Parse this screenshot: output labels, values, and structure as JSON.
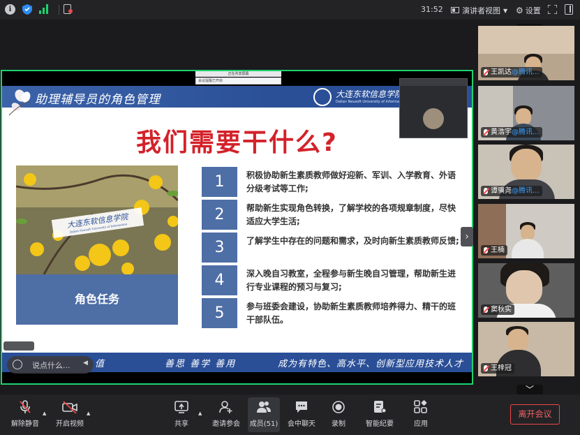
{
  "topbar": {
    "timer": "31:52",
    "presenter_view": "演讲者视图",
    "settings": "设置"
  },
  "share": {
    "toolbar_text": "正在共享屏幕",
    "alert_text": "会议提醒已开启"
  },
  "slide": {
    "title": "助理辅导员的角色管理",
    "university": "大连东软信息学院",
    "university_en": "Dalian Neusoft University of Information",
    "headline": "我们需要干什么?",
    "photo_label": "大连东软信息学院",
    "photo_label_en": "Dalian Neusoft University of Information",
    "role_label": "角色任务",
    "tasks": [
      {
        "num": "1",
        "text": "积极协助新生素质教师做好迎新、军训、入学教育、外语分级考试等工作;"
      },
      {
        "num": "2",
        "text": "帮助新生实现角色转换，了解学校的各项规章制度，尽快适应大学生活;"
      },
      {
        "num": "3",
        "text": "了解学生中存在的问题和需求，及时向新生素质教师反馈;"
      },
      {
        "num": "4",
        "text": "深入晚自习教室，全程参与新生晚自习管理，帮助新生进行专业课程的预习与复习;"
      },
      {
        "num": "5",
        "text": "参与班委会建设，协助新生素质教师培养得力、精干的班干部队伍。"
      }
    ],
    "footer_left": "值",
    "footer_mid": "善思 善学 善用",
    "footer_right": "成为有特色、高水平、创新型应用技术人才"
  },
  "chat": {
    "placeholder": "说点什么..."
  },
  "participants": [
    {
      "name": "王凯达",
      "org": "@腾讯..."
    },
    {
      "name": "黄浩宇",
      "org": "@腾讯..."
    },
    {
      "name": "谭骥尧",
      "org": "@腾讯..."
    },
    {
      "name": "王楠",
      "org": ""
    },
    {
      "name": "窦秋实",
      "org": ""
    },
    {
      "name": "王梓冠",
      "org": ""
    }
  ],
  "toolbar": {
    "mute": "解除静音",
    "video": "开启视频",
    "share": "共享",
    "invite": "邀请参会",
    "members": "成员(51)",
    "chat": "会中聊天",
    "record": "录制",
    "notes": "智能纪要",
    "apps": "应用",
    "leave": "离开会议"
  },
  "colors": {
    "share_border": "#1bd36f",
    "slide_blue": "#2a4f97",
    "headline_red": "#d3222a",
    "leave_red": "#f04747",
    "mention_blue": "#3da0ff"
  }
}
